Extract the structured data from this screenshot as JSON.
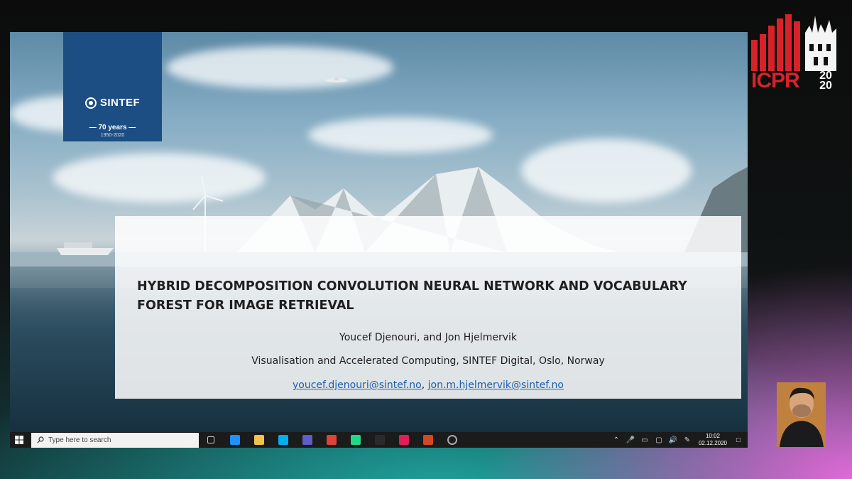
{
  "slide": {
    "sintef": {
      "logo_text": "SINTEF",
      "years": "— 70 years —",
      "range": "1950-2020"
    },
    "title": "HYBRID DECOMPOSITION CONVOLUTION NEURAL NETWORK AND VOCABULARY FOREST FOR IMAGE RETRIEVAL",
    "authors": "Youcef Djenouri, and Jon Hjelmervik",
    "affiliation": "Visualisation and Accelerated Computing, SINTEF Digital, Oslo, Norway",
    "emails": [
      {
        "text": "youcef.djenouri@sintef.no"
      },
      {
        "text": "jon.m.hjelmervik@sintef.no"
      }
    ],
    "email_separator": ", "
  },
  "taskbar": {
    "search_placeholder": "Type here to search",
    "apps": [
      {
        "icon": "task-view-icon",
        "color": "#1b1b1b"
      },
      {
        "icon": "edge-icon",
        "color": "#1e90ff"
      },
      {
        "icon": "file-explorer-icon",
        "color": "#f2c14e"
      },
      {
        "icon": "skype-icon",
        "color": "#00aff0"
      },
      {
        "icon": "teams-icon",
        "color": "#5b5fc7"
      },
      {
        "icon": "chrome-icon",
        "color": "#db4437"
      },
      {
        "icon": "pycharm-icon",
        "color": "#21d789"
      },
      {
        "icon": "terminal-icon",
        "color": "#2b2b2b"
      },
      {
        "icon": "slack-icon",
        "color": "#e01e5a"
      },
      {
        "icon": "powerpoint-icon",
        "color": "#d24726"
      },
      {
        "icon": "cortana-icon",
        "color": "#555555"
      }
    ],
    "clock_time": "10:02",
    "clock_date": "02.12.2020"
  },
  "branding": {
    "icpr_text": "ICPR",
    "icpr_year_top": "20",
    "icpr_year_bottom": "20",
    "icpr_color": "#d8222a"
  },
  "colors": {
    "sintef_blue": "#1c4e83",
    "link_blue": "#1f5ea8"
  }
}
